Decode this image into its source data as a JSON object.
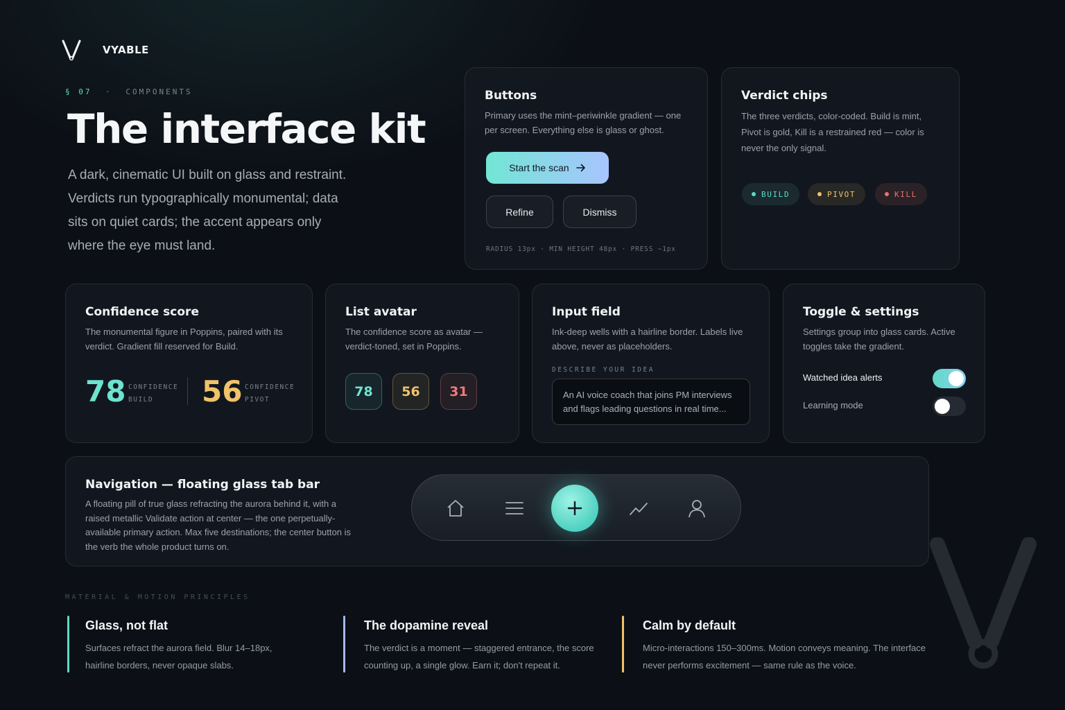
{
  "brand": {
    "name": "VYABLE",
    "icon": "v-mark-icon"
  },
  "hero": {
    "eyebrow_section": "§ 07",
    "eyebrow_sep": "·",
    "eyebrow_label": "COMPONENTS",
    "title": "The interface kit",
    "subtitle": "A dark, cinematic UI built on glass and restraint. Verdicts run typographically monumental; data sits on quiet cards; the accent appears only where the eye must land."
  },
  "buttons_card": {
    "title": "Buttons",
    "desc": "Primary uses the mint–periwinkle gradient — one per screen. Everything else is glass or ghost.",
    "primary_label": "Start the scan",
    "primary_icon": "arrow-right-icon",
    "refine_label": "Refine",
    "dismiss_label": "Dismiss",
    "spec": "RADIUS 13px  ·  MIN HEIGHT 48px  ·  PRESS −1px"
  },
  "chips_card": {
    "title": "Verdict chips",
    "desc": "The three verdicts, color-coded. Build is mint, Pivot is gold, Kill is a restrained red — color is never the only signal.",
    "chips": [
      {
        "label": "BUILD",
        "color": "#5fd9c7"
      },
      {
        "label": "PIVOT",
        "color": "#f0c26a"
      },
      {
        "label": "KILL",
        "color": "#e8736f"
      }
    ]
  },
  "confidence_card": {
    "title": "Confidence score",
    "desc": "The monumental figure in Poppins, paired with its verdict. Gradient fill reserved for Build.",
    "scores": [
      {
        "value": "78",
        "label1": "CONFIDENCE",
        "label2": "BUILD",
        "color": "#6ee3cf"
      },
      {
        "value": "56",
        "label1": "CONFIDENCE",
        "label2": "PIVOT",
        "color": "#f0c26a"
      }
    ]
  },
  "avatar_card": {
    "title": "List avatar",
    "desc": "The confidence score as avatar — verdict-toned, set in Poppins.",
    "avatars": [
      {
        "value": "78",
        "color": "#6ee3cf"
      },
      {
        "value": "56",
        "color": "#f0c26a"
      },
      {
        "value": "31",
        "color": "#f07a76"
      }
    ]
  },
  "input_card": {
    "title": "Input field",
    "desc": "Ink-deep wells with a hairline border. Labels live above, never as placeholders.",
    "field_label": "DESCRIBE YOUR IDEA",
    "field_value": "An AI voice coach that joins PM interviews and flags leading questions in real time..."
  },
  "toggle_card": {
    "title": "Toggle & settings",
    "desc": "Settings group into glass cards. Active toggles take the gradient.",
    "toggles": [
      {
        "label": "Watched idea alerts",
        "on": true
      },
      {
        "label": "Learning mode",
        "on": false
      }
    ]
  },
  "nav_card": {
    "title": "Navigation — floating glass tab bar",
    "desc": "A floating pill of true glass refracting the aurora behind it, with a raised metallic Validate action at center — the one perpetually-available primary action. Max five destinations; the center button is the verb the whole product turns on.",
    "tabs": [
      "home-icon",
      "list-icon",
      "plus-icon",
      "trend-icon",
      "profile-icon"
    ]
  },
  "principles": {
    "section_label": "MATERIAL & MOTION PRINCIPLES",
    "items": [
      {
        "title": "Glass, not flat",
        "text": "Surfaces refract the aurora field. Blur 14–18px, hairline borders, never opaque slabs.",
        "color": "#5fd9c7"
      },
      {
        "title": "The dopamine reveal",
        "text": "The verdict is a moment — staggered entrance, the score counting up, a single glow. Earn it; don't repeat it.",
        "color": "#a6b6f0"
      },
      {
        "title": "Calm by default",
        "text": "Micro-interactions 150–300ms. Motion conveys meaning. The interface never performs excitement — same rule as the voice.",
        "color": "#f0c26a"
      }
    ]
  }
}
